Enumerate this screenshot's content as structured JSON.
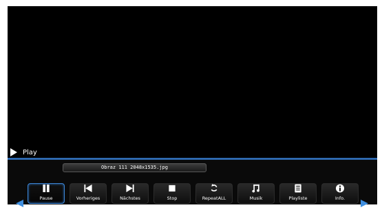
{
  "status": {
    "label": "Play"
  },
  "file": {
    "name": "Obraz 111 2048x1535.jpg"
  },
  "controls": [
    {
      "label": "Pause",
      "icon": "pause-icon",
      "active": true
    },
    {
      "label": "Vorheriges",
      "icon": "skip-back-icon"
    },
    {
      "label": "Nächstes",
      "icon": "skip-forward-icon"
    },
    {
      "label": "Stop",
      "icon": "stop-icon"
    },
    {
      "label": "RepeatALL",
      "icon": "repeat-icon"
    },
    {
      "label": "Musik",
      "icon": "music-note-icon"
    },
    {
      "label": "Playliste",
      "icon": "playlist-icon"
    },
    {
      "label": "Info.",
      "icon": "info-icon"
    }
  ],
  "colors": {
    "accent": "#3a7bc8",
    "background": "#000000",
    "text": "#ffffff"
  }
}
